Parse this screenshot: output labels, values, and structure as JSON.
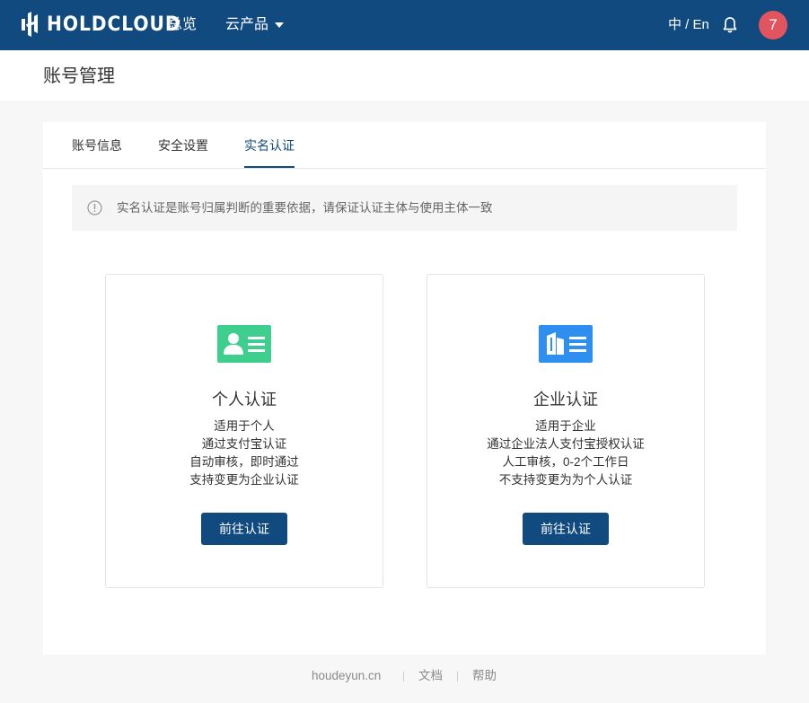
{
  "topbar": {
    "logo_text": "HOLDCLOUD",
    "nav": {
      "overview": "总览",
      "products": "云产品"
    },
    "lang": "中 / En",
    "avatar_text": "7"
  },
  "page": {
    "title": "账号管理"
  },
  "tabs": [
    {
      "label": "账号信息",
      "active": false
    },
    {
      "label": "安全设置",
      "active": false
    },
    {
      "label": "实名认证",
      "active": true
    }
  ],
  "notice": {
    "text": "实名认证是账号归属判断的重要依据，请保证认证主体与使用主体一致"
  },
  "options": [
    {
      "icon": "id-card-icon",
      "title": "个人认证",
      "lines": [
        "适用于个人",
        "通过支付宝认证",
        "自动审核，即时通过",
        "支持变更为企业认证"
      ],
      "button": "前往认证",
      "color": "#3ecf8e"
    },
    {
      "icon": "building-card-icon",
      "title": "企业认证",
      "lines": [
        "适用于企业",
        "通过企业法人支付宝授权认证",
        "人工审核，0-2个工作日",
        "不支持变更为为个人认证"
      ],
      "button": "前往认证",
      "color": "#2f8ff0"
    }
  ],
  "footer": {
    "site": "houdeyun.cn",
    "docs": "文档",
    "help": "帮助"
  },
  "colors": {
    "brand": "#114a7f",
    "avatar": "#e2545e"
  }
}
